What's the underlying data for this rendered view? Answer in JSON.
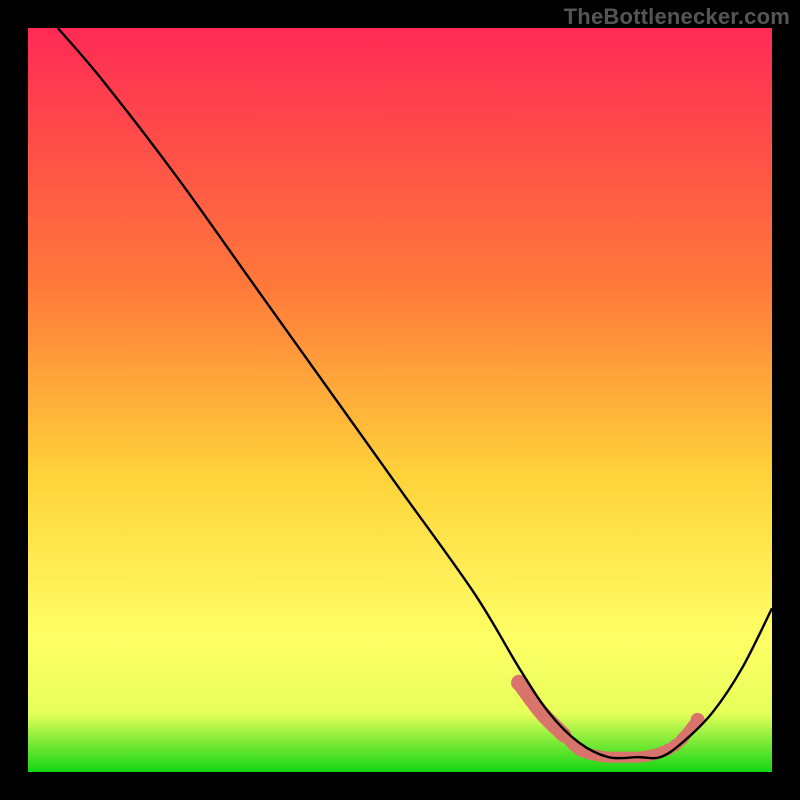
{
  "watermark": "TheBottlenecker.com",
  "colors": {
    "bg": "#000000",
    "curve": "#000000",
    "marker": "#d9746c",
    "grad_top": "#ff2a55",
    "grad_mid1": "#ff7a3a",
    "grad_mid2": "#ffd23a",
    "grad_mid3": "#ffff66",
    "grad_bottom": "#13d613"
  },
  "chart_data": {
    "type": "line",
    "title": "",
    "xlabel": "",
    "ylabel": "",
    "xlim": [
      0,
      100
    ],
    "ylim": [
      0,
      100
    ],
    "series": [
      {
        "name": "curve",
        "x": [
          4,
          10,
          20,
          30,
          40,
          50,
          60,
          66,
          70,
          74,
          78,
          82,
          85,
          88,
          92,
          96,
          100
        ],
        "y": [
          100,
          93,
          80,
          66,
          52,
          38,
          24,
          14,
          8,
          4,
          2,
          2,
          2,
          4,
          8,
          14,
          22
        ]
      }
    ],
    "markers": {
      "name": "highlight-band",
      "x": [
        66,
        69,
        72,
        74,
        76,
        78,
        80,
        82,
        84,
        86,
        87,
        88,
        90
      ],
      "y": [
        12,
        8,
        5,
        3,
        2.3,
        2,
        2,
        2,
        2.3,
        3,
        3.6,
        4.5,
        7
      ]
    }
  }
}
